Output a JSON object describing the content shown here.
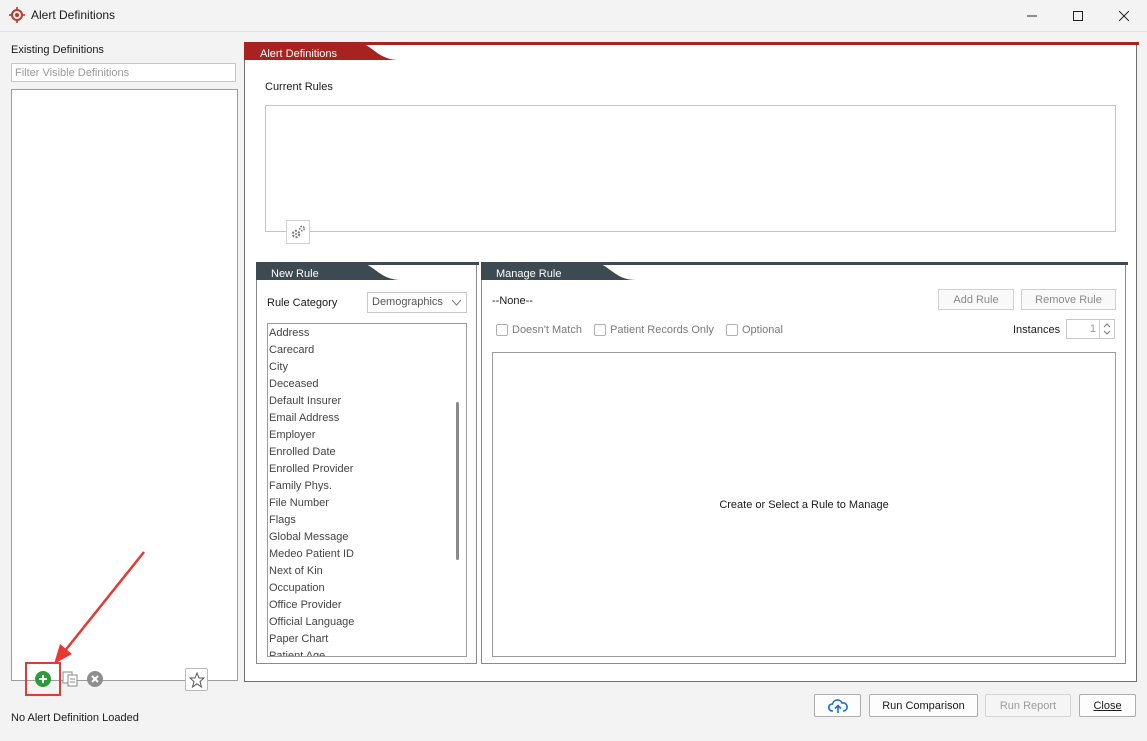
{
  "window": {
    "title": "Alert Definitions",
    "controls": [
      "minimize-icon",
      "maximize-icon",
      "close-icon"
    ]
  },
  "left_panel": {
    "heading": "Existing Definitions",
    "filter_placeholder": "Filter Visible Definitions",
    "filter_value": "",
    "definitions": [],
    "toolbar": [
      "add-definition-icon",
      "copy-definition-icon",
      "delete-definition-icon",
      "favorite-star-icon"
    ],
    "status": "No Alert Definition Loaded"
  },
  "main_panel": {
    "tab_title": "Alert Definitions",
    "current_rules_label": "Current Rules",
    "current_rules": []
  },
  "new_rule": {
    "tab_title": "New Rule",
    "category_label": "Rule Category",
    "category_value": "Demographics",
    "fields": [
      "Address",
      "Carecard",
      "City",
      "Deceased",
      "Default Insurer",
      "Email Address",
      "Employer",
      "Enrolled Date",
      "Enrolled Provider",
      "Family Phys.",
      "File Number",
      "Flags",
      "Global Message",
      "Medeo Patient ID",
      "Next of Kin",
      "Occupation",
      "Office Provider",
      "Official Language",
      "Paper Chart",
      "Patient Age"
    ]
  },
  "manage_rule": {
    "tab_title": "Manage Rule",
    "selected_rule": "--None--",
    "add_rule_label": "Add Rule",
    "remove_rule_label": "Remove Rule",
    "options": {
      "doesnt_match": "Doesn't Match",
      "patient_records_only": "Patient Records Only",
      "optional": "Optional"
    },
    "instances_label": "Instances",
    "instances_value": "1",
    "empty_message": "Create or Select a Rule to Manage"
  },
  "footer": {
    "upload_icon": "cloud-upload-icon",
    "run_comparison_label": "Run Comparison",
    "run_report_label": "Run Report",
    "close_label": "Close"
  },
  "colors": {
    "accent_red": "#a8231f",
    "tab_dark": "#3d4a52",
    "highlight_red": "#e53935"
  }
}
